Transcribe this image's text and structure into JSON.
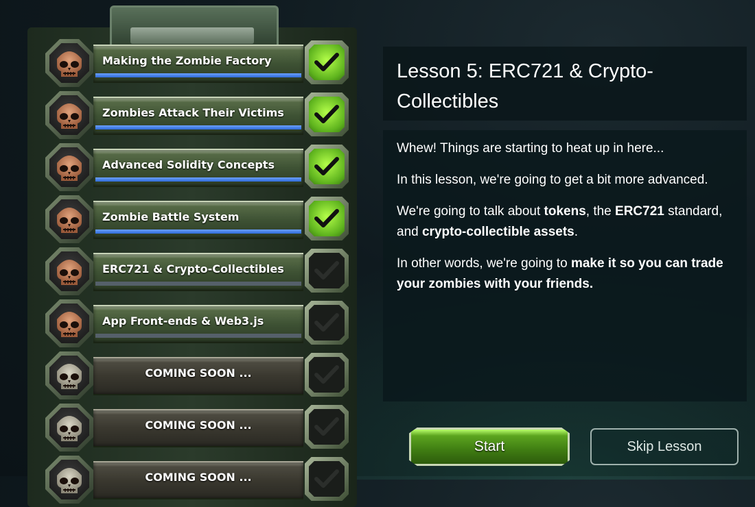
{
  "lessons": [
    {
      "title": "Making the Zombie Factory",
      "completed": true,
      "locked": false,
      "progress": 1.0,
      "icon": "zombie-skull-icon"
    },
    {
      "title": "Zombies Attack Their Victims",
      "completed": true,
      "locked": false,
      "progress": 1.0,
      "icon": "zombie-skull-icon"
    },
    {
      "title": "Advanced Solidity Concepts",
      "completed": true,
      "locked": false,
      "progress": 1.0,
      "icon": "zombie-skull-icon"
    },
    {
      "title": "Zombie Battle System",
      "completed": true,
      "locked": false,
      "progress": 1.0,
      "icon": "zombie-skull-icon"
    },
    {
      "title": "ERC721 & Crypto-Collectibles",
      "completed": false,
      "locked": false,
      "progress": 0.0,
      "icon": "zombie-skull-icon"
    },
    {
      "title": "App Front-ends & Web3.js",
      "completed": false,
      "locked": false,
      "progress": 0.0,
      "icon": "zombie-skull-icon"
    },
    {
      "title": "COMING SOON ...",
      "completed": false,
      "locked": true,
      "progress": 0.0,
      "icon": "locked-skull-icon"
    },
    {
      "title": "COMING SOON ...",
      "completed": false,
      "locked": true,
      "progress": 0.0,
      "icon": "locked-skull-icon"
    },
    {
      "title": "COMING SOON ...",
      "completed": false,
      "locked": true,
      "progress": 0.0,
      "icon": "locked-skull-icon"
    }
  ],
  "detail": {
    "title": "Lesson 5: ERC721 & Crypto-Collectibles",
    "paragraphs": [
      [
        {
          "t": "Whew! Things are starting to heat up in here...",
          "b": false
        }
      ],
      [
        {
          "t": "In this lesson, we're going to get a bit more advanced.",
          "b": false
        }
      ],
      [
        {
          "t": "We're going to talk about ",
          "b": false
        },
        {
          "t": "tokens",
          "b": true
        },
        {
          "t": ", the ",
          "b": false
        },
        {
          "t": "ERC721",
          "b": true
        },
        {
          "t": " standard, and ",
          "b": false
        },
        {
          "t": "crypto-collectible assets",
          "b": true
        },
        {
          "t": ".",
          "b": false
        }
      ],
      [
        {
          "t": "In other words, we're going to ",
          "b": false
        },
        {
          "t": "make it so you can trade your zombies with your friends.",
          "b": true
        }
      ]
    ]
  },
  "buttons": {
    "start": "Start",
    "skip": "Skip Lesson"
  },
  "colors": {
    "progress": "#2f6bd6",
    "check_done": "#7fd42a",
    "start_button": "#4a8f18"
  }
}
